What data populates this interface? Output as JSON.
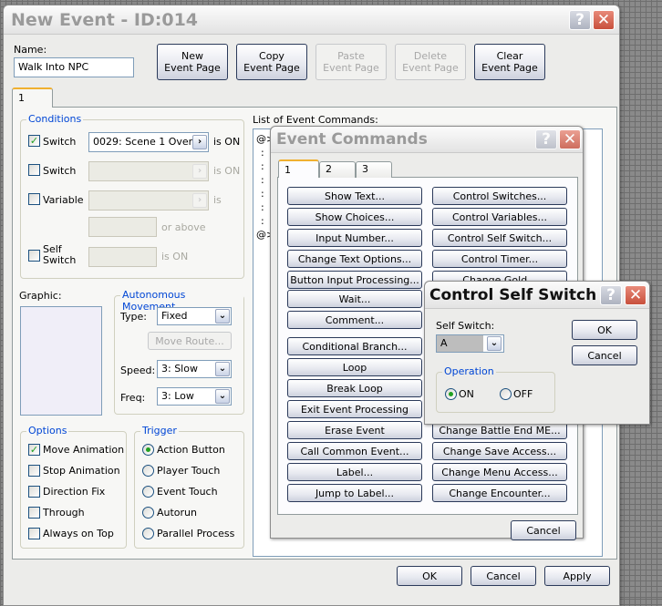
{
  "event_window": {
    "title": "New Event - ID:014",
    "name_label": "Name:",
    "name_value": "Walk Into NPC",
    "buttons": {
      "new": "New\nEvent Page",
      "copy": "Copy\nEvent Page",
      "paste": "Paste\nEvent Page",
      "delete": "Delete\nEvent Page",
      "clear": "Clear\nEvent Page"
    },
    "page_tab": "1",
    "conditions": {
      "legend": "Conditions",
      "switch1": {
        "label": "Switch",
        "checked": true,
        "value": "0029: Scene 1 Over",
        "suffix": "is ON"
      },
      "switch2": {
        "label": "Switch",
        "checked": false,
        "value": "",
        "suffix": "is ON"
      },
      "variable": {
        "label": "Variable",
        "checked": false,
        "value": "",
        "suffix": "is",
        "or_above": "or above"
      },
      "self_switch": {
        "label": "Self\nSwitch",
        "checked": false,
        "suffix": "is ON"
      }
    },
    "graphic_label": "Graphic:",
    "autonomous": {
      "legend": "Autonomous Movement",
      "type_label": "Type:",
      "type_value": "Fixed",
      "move_route": "Move Route...",
      "speed_label": "Speed:",
      "speed_value": "3: Slow",
      "freq_label": "Freq:",
      "freq_value": "3: Low"
    },
    "options": {
      "legend": "Options",
      "items": [
        {
          "label": "Move Animation",
          "checked": true
        },
        {
          "label": "Stop Animation",
          "checked": false
        },
        {
          "label": "Direction Fix",
          "checked": false
        },
        {
          "label": "Through",
          "checked": false
        },
        {
          "label": "Always on Top",
          "checked": false
        }
      ]
    },
    "trigger": {
      "legend": "Trigger",
      "items": [
        {
          "label": "Action Button",
          "selected": true
        },
        {
          "label": "Player Touch",
          "selected": false
        },
        {
          "label": "Event Touch",
          "selected": false
        },
        {
          "label": "Autorun",
          "selected": false
        },
        {
          "label": "Parallel Process",
          "selected": false
        }
      ]
    },
    "commands_label": "List of Event Commands:",
    "command_lines": [
      "@>",
      ":",
      ":",
      ":",
      ":",
      ":",
      ":",
      "@>"
    ],
    "ok": "OK",
    "cancel": "Cancel",
    "apply": "Apply"
  },
  "event_commands": {
    "title": "Event Commands",
    "tabs": [
      "1",
      "2",
      "3"
    ],
    "left": [
      "Show Text...",
      "Show Choices...",
      "Input Number...",
      "Change Text Options...",
      "Button Input Processing...",
      "Wait...",
      "Comment...",
      "Conditional Branch...",
      "Loop",
      "Break Loop",
      "Exit Event Processing",
      "Erase Event",
      "Call Common Event...",
      "Label...",
      "Jump to Label..."
    ],
    "right_top": [
      "Control Switches...",
      "Control Variables...",
      "Control Self Switch...",
      "Control Timer...",
      "Change Gold..."
    ],
    "right_bottom": [
      "Change Battle End ME...",
      "Change Save Access...",
      "Change Menu Access...",
      "Change Encounter..."
    ],
    "cancel": "Cancel"
  },
  "self_switch_dialog": {
    "title": "Control Self Switch",
    "self_switch_label": "Self Switch:",
    "self_switch_value": "A",
    "operation_legend": "Operation",
    "on": "ON",
    "off": "OFF",
    "selected": "ON",
    "ok": "OK",
    "cancel": "Cancel"
  }
}
